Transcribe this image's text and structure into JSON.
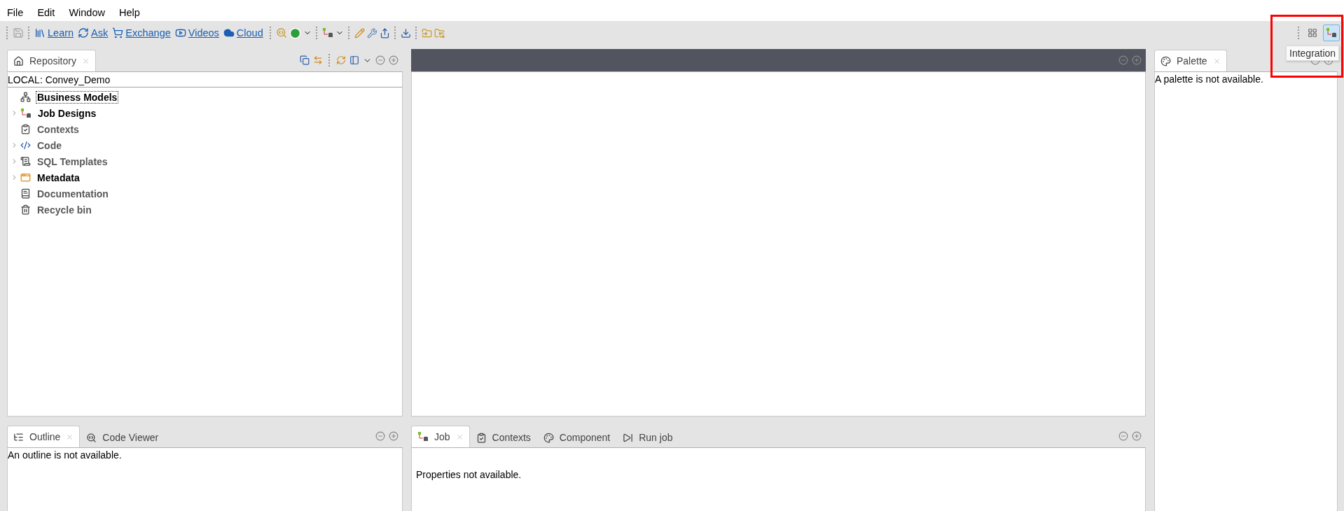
{
  "menu": [
    "File",
    "Edit",
    "Window",
    "Help"
  ],
  "toolbar": {
    "links": [
      {
        "kind": "learn",
        "label": "Learn"
      },
      {
        "kind": "ask",
        "label": "Ask"
      },
      {
        "kind": "exchange",
        "label": "Exchange"
      },
      {
        "kind": "videos",
        "label": "Videos"
      },
      {
        "kind": "cloud",
        "label": "Cloud"
      }
    ],
    "perspectives": [
      {
        "kind": "other",
        "selected": false
      },
      {
        "kind": "integration",
        "selected": true
      }
    ],
    "tooltip": "Integration"
  },
  "repository": {
    "tab": {
      "label": "Repository",
      "selected": true
    },
    "project": "LOCAL: Convey_Demo",
    "items": [
      {
        "kind": "models",
        "label": "Business Models",
        "expandable": false,
        "dimmed": false,
        "selected": true
      },
      {
        "kind": "jobs",
        "label": "Job Designs",
        "expandable": true,
        "dimmed": false,
        "selected": false
      },
      {
        "kind": "contexts",
        "label": "Contexts",
        "expandable": false,
        "dimmed": true,
        "selected": false
      },
      {
        "kind": "code",
        "label": "Code",
        "expandable": true,
        "dimmed": true,
        "selected": false
      },
      {
        "kind": "sql",
        "label": "SQL Templates",
        "expandable": true,
        "dimmed": true,
        "selected": false
      },
      {
        "kind": "metadata",
        "label": "Metadata",
        "expandable": true,
        "dimmed": false,
        "selected": false
      },
      {
        "kind": "docs",
        "label": "Documentation",
        "expandable": false,
        "dimmed": true,
        "selected": false
      },
      {
        "kind": "bin",
        "label": "Recycle bin",
        "expandable": false,
        "dimmed": true,
        "selected": false
      }
    ]
  },
  "palette": {
    "tab": {
      "label": "Palette",
      "selected": true
    },
    "message": "A palette is not available."
  },
  "outline": {
    "tabs": [
      {
        "kind": "outline",
        "label": "Outline",
        "selected": true
      },
      {
        "kind": "viewer",
        "label": "Code Viewer",
        "selected": false
      }
    ],
    "message": "An outline is not available."
  },
  "properties": {
    "tabs": [
      {
        "kind": "jobs",
        "label": "Job",
        "selected": true
      },
      {
        "kind": "contexts",
        "label": "Contexts",
        "selected": false
      },
      {
        "kind": "component",
        "label": "Component",
        "selected": false
      },
      {
        "kind": "run",
        "label": "Run job",
        "selected": false
      }
    ],
    "message": "Properties not available."
  },
  "highlight": true
}
